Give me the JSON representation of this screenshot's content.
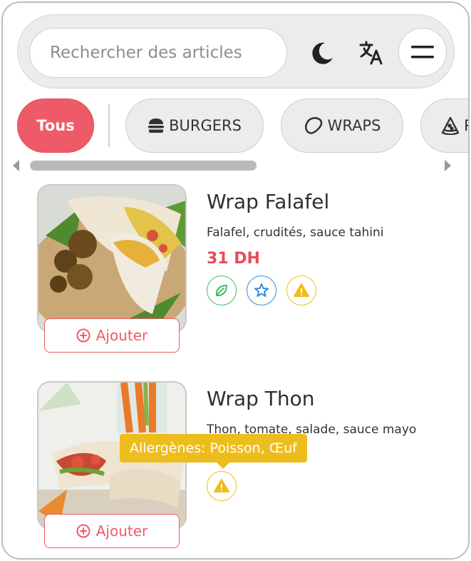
{
  "search": {
    "placeholder": "Rechercher des articles"
  },
  "header": {
    "icons": [
      "moon-icon",
      "translate-icon",
      "menu-icon"
    ]
  },
  "categories": [
    {
      "label": "Tous",
      "active": true
    },
    {
      "label": "BURGERS",
      "icon": "burger-icon"
    },
    {
      "label": "WRAPS",
      "icon": "wrap-icon"
    },
    {
      "label": "P",
      "icon": "pizza-icon"
    }
  ],
  "products": [
    {
      "name": "Wrap Falafel",
      "description": "Falafel, crudités, sauce tahini",
      "price": "31 DH",
      "badges": [
        "leaf-icon",
        "star-icon",
        "warning-icon"
      ],
      "add_label": "Ajouter"
    },
    {
      "name": "Wrap Thon",
      "description": "Thon, tomate, salade, sauce mayo",
      "tooltip": "Allergènes: Poisson, Œuf",
      "badges": [
        "warning-icon"
      ],
      "add_label": "Ajouter"
    }
  ],
  "colors": {
    "accent": "#ef5a68",
    "price": "#ea4a5a",
    "vegan": "#3bbf5a",
    "star": "#2f8de0",
    "allergen": "#edbd1d"
  }
}
